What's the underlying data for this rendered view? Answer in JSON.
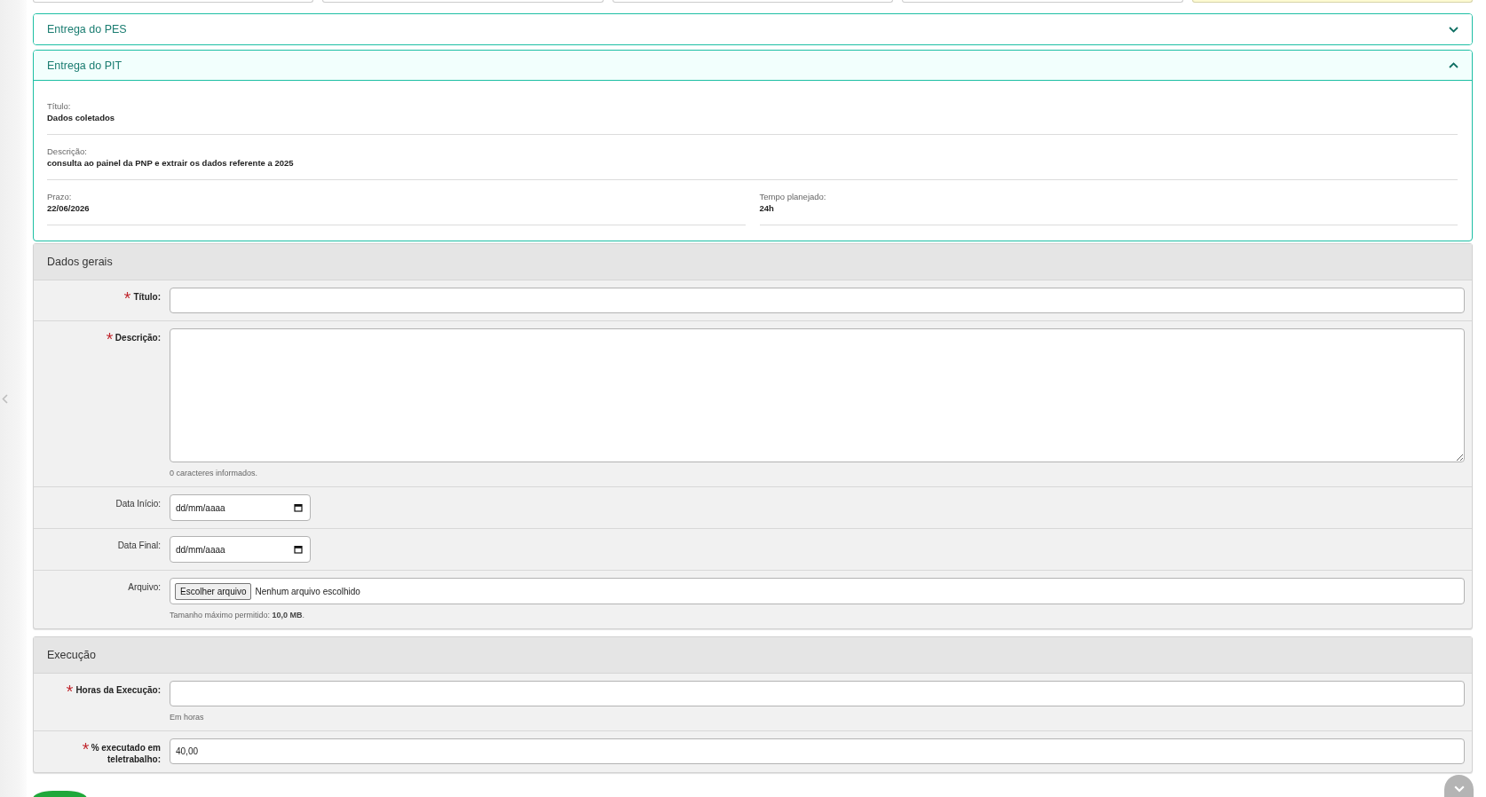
{
  "top_cards": [
    {
      "highlighted": false
    },
    {
      "highlighted": false
    },
    {
      "highlighted": false
    },
    {
      "highlighted": false
    },
    {
      "highlighted": true
    }
  ],
  "accordions": [
    {
      "title": "Entrega do PES",
      "expanded": false
    },
    {
      "title": "Entrega do PIT",
      "expanded": true,
      "details": [
        {
          "fields": [
            {
              "label": "Título:",
              "value": "Dados coletados"
            }
          ]
        },
        {
          "fields": [
            {
              "label": "Descrição:",
              "value": "consulta ao painel da PNP e extrair os dados referente a 2025"
            }
          ]
        },
        {
          "fields": [
            {
              "label": "Prazo:",
              "value": "22/06/2026"
            },
            {
              "label": "Tempo planejado:",
              "value": "24h"
            }
          ]
        }
      ]
    }
  ],
  "sections": [
    {
      "title": "Dados gerais",
      "fields": [
        {
          "kind": "text",
          "label": "Título:",
          "required": true
        },
        {
          "kind": "textarea",
          "label": "Descrição:",
          "required": true,
          "hint": "0 caracteres informados."
        },
        {
          "kind": "date",
          "label": "Data Início:",
          "required": false,
          "placeholder": "dd/mm/aaaa"
        },
        {
          "kind": "date",
          "label": "Data Final:",
          "required": false,
          "placeholder": "dd/mm/aaaa"
        },
        {
          "kind": "file",
          "label": "Arquivo:",
          "required": false,
          "button": "Escolher arquivo",
          "status": "Nenhum arquivo escolhido",
          "hint": "Tamanho máximo permitido: **10,0 MB**."
        }
      ]
    },
    {
      "title": "Execução",
      "fields": [
        {
          "kind": "text",
          "label": "Horas da Execução:",
          "required": true,
          "hint": "Em horas"
        },
        {
          "kind": "text",
          "label": "% executado em teletrabalho:",
          "required": true,
          "value": "40,00"
        }
      ]
    }
  ]
}
